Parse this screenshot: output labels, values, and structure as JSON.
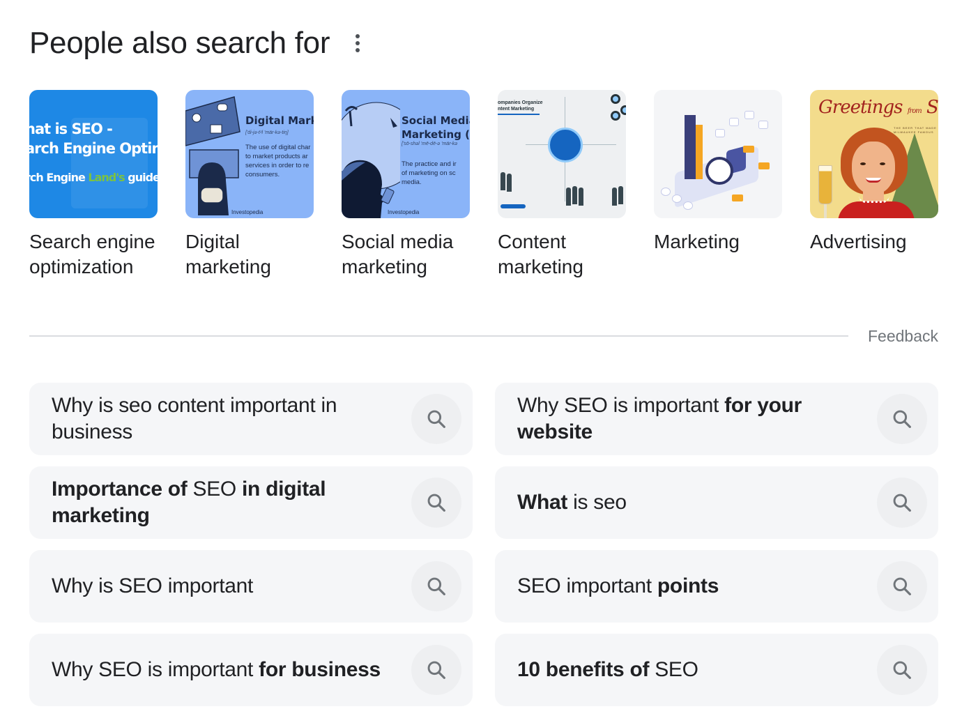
{
  "header": {
    "title": "People also search for",
    "more_icon": "more-vert-icon"
  },
  "entities": [
    {
      "label": "Search engine optimization",
      "thumb": {
        "line1": "hat is SEO -",
        "line2": "arch Engine Optimiz",
        "line3a": "rch Engine ",
        "line3b": "Land's",
        "line3c": " guide to"
      }
    },
    {
      "label": "Digital marketing",
      "thumb": {
        "heading": "Digital Marke",
        "phonetic": "['di-jə-tᵊl 'mär-kə-tiŋ]",
        "desc1": "The use of digital char",
        "desc2": "to market products ar",
        "desc3": "services in order to re",
        "desc4": "consumers.",
        "brand": "Investopedia"
      }
    },
    {
      "label": "Social media marketing",
      "thumb": {
        "heading1": "Social Media",
        "heading2": "Marketing (S",
        "phonetic": "['sō-shəl 'mē-dē-ə 'mär-kə",
        "desc1": "The practice and ir",
        "desc2": "of marketing on sc",
        "desc3": "media.",
        "brand": "Investopedia"
      }
    },
    {
      "label": "Content marketing",
      "thumb": {
        "heading1": "ompanies Organize",
        "heading2": "ntent Marketing"
      }
    },
    {
      "label": "Marketing",
      "thumb": {}
    },
    {
      "label": "Advertising",
      "thumb": {
        "script_a": "Greetings ",
        "script_b": "from",
        "script_c": " Schlitz",
        "sub1": "THE BEER THAT MADE",
        "sub2": "MILWAUKEE FAMOUS"
      }
    }
  ],
  "feedback": "Feedback",
  "related_searches": [
    {
      "parts": [
        {
          "text": "Why is seo content important in business",
          "bold": false
        }
      ]
    },
    {
      "parts": [
        {
          "text": "Why SEO is important ",
          "bold": false
        },
        {
          "text": "for your website",
          "bold": true
        }
      ]
    },
    {
      "parts": [
        {
          "text": "Importance of",
          "bold": true
        },
        {
          "text": " SEO ",
          "bold": false
        },
        {
          "text": "in digital marketing",
          "bold": true
        }
      ]
    },
    {
      "parts": [
        {
          "text": "What",
          "bold": true
        },
        {
          "text": " is seo",
          "bold": false
        }
      ]
    },
    {
      "parts": [
        {
          "text": "Why is SEO important",
          "bold": false
        }
      ]
    },
    {
      "parts": [
        {
          "text": "SEO important ",
          "bold": false
        },
        {
          "text": "points",
          "bold": true
        }
      ]
    },
    {
      "parts": [
        {
          "text": "Why SEO is important ",
          "bold": false
        },
        {
          "text": "for business",
          "bold": true
        }
      ]
    },
    {
      "parts": [
        {
          "text": "10 benefits of",
          "bold": true
        },
        {
          "text": " SEO",
          "bold": false
        }
      ]
    }
  ],
  "colors": {
    "text": "#202124",
    "secondary_text": "#70757a",
    "chip_bg": "#f5f6f8",
    "icon_gray": "#70757a"
  }
}
